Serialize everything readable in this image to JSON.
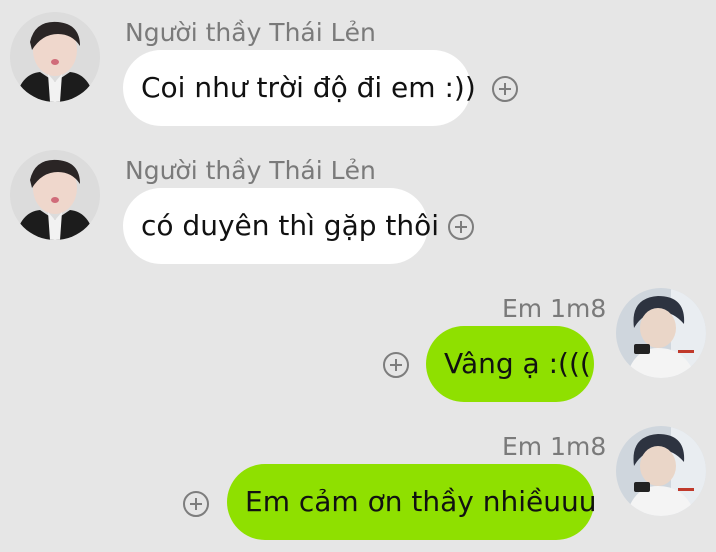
{
  "messages": [
    {
      "direction": "incoming",
      "sender": "Người thầy Thái Lẻn",
      "text": "Coi như trời độ đi em :))",
      "avatar_icon": "avatar-teacher-icon",
      "reaction_icon": "add-reaction-icon"
    },
    {
      "direction": "incoming",
      "sender": "Người thầy Thái Lẻn",
      "text": "có duyên thì gặp thôi",
      "avatar_icon": "avatar-teacher-icon",
      "reaction_icon": "add-reaction-icon"
    },
    {
      "direction": "outgoing",
      "sender": "Em 1m8",
      "text": "Vâng ạ :(((",
      "avatar_icon": "avatar-student-icon",
      "reaction_icon": "add-reaction-icon"
    },
    {
      "direction": "outgoing",
      "sender": "Em 1m8",
      "text": "Em cảm ơn thầy nhiềuuu",
      "avatar_icon": "avatar-student-icon",
      "reaction_icon": "add-reaction-icon"
    }
  ],
  "colors": {
    "background": "#e6e6e6",
    "incoming_bubble": "#ffffff",
    "outgoing_bubble": "#8fe000",
    "sender_name": "#7a7a7a"
  }
}
